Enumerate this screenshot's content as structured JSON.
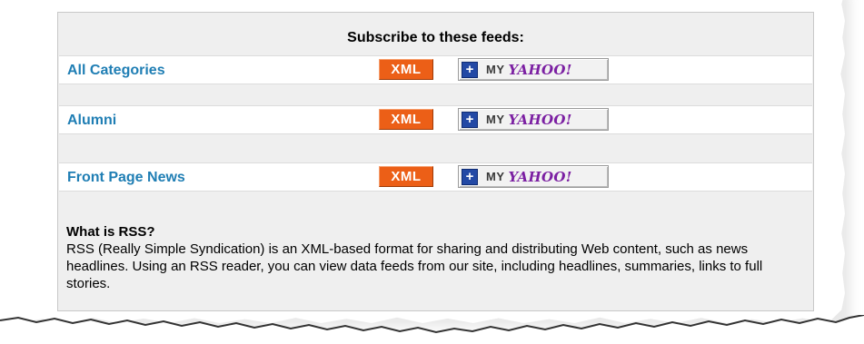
{
  "feeds": {
    "heading": "Subscribe to these feeds:",
    "items": [
      {
        "label": "All Categories",
        "xml_label": "XML",
        "yahoo_my": "MY",
        "yahoo_logo": "YAHOO!"
      },
      {
        "label": "Alumni",
        "xml_label": "XML",
        "yahoo_my": "MY",
        "yahoo_logo": "YAHOO!"
      },
      {
        "label": "Front Page News",
        "xml_label": "XML",
        "yahoo_my": "MY",
        "yahoo_logo": "YAHOO!"
      }
    ],
    "plus_glyph": "+"
  },
  "rss_info": {
    "title": "What is RSS?",
    "body": "RSS (Really Simple Syndication) is an XML-based format for sharing and distributing Web content, such as news headlines. Using an RSS reader, you can view data feeds from our site, including headlines, summaries, links to full stories."
  },
  "colors": {
    "link": "#1f7eb4",
    "xml_badge": "#ec5f17",
    "yahoo_plus": "#2349a5",
    "yahoo_logo": "#7b1fa2",
    "panel_bg": "#efefef"
  },
  "icons": {
    "add": "plus-icon",
    "yahoo": "yahoo-logo-icon"
  }
}
